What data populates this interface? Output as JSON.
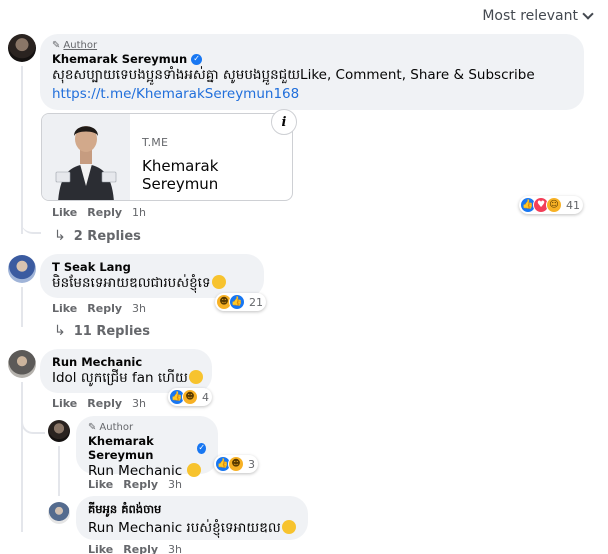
{
  "sort": {
    "label": "Most relevant"
  },
  "comments": [
    {
      "author_tag": "Author",
      "name": "Khemarak Sereymun",
      "text": "សុខសប្បាយទេបងប្អូនទាំងអស់គ្នា សូមបងប្អូនជួយLike, Comment, Share & Subscribe",
      "link": "https://t.me/KhemarakSereymun168",
      "card": {
        "domain": "T.ME",
        "title": "Khemarak Sereymun"
      },
      "like": "Like",
      "reply": "Reply",
      "time": "1h",
      "reaction_count": "41",
      "replies_label": "2 Replies"
    },
    {
      "name": "T Seak Lang",
      "text": "មិនមែនទេអាយឌលជារបស់ខ្ញុំទេ",
      "like": "Like",
      "reply": "Reply",
      "time": "3h",
      "reaction_count": "21",
      "replies_label": "11 Replies"
    },
    {
      "name": "Run Mechanic",
      "text": "Idol លូកជ្រើម fan ហើយ",
      "like": "Like",
      "reply": "Reply",
      "time": "3h",
      "reaction_count": "4",
      "replies": [
        {
          "author_tag": "Author",
          "name": "Khemarak Sereymun",
          "text": "Run Mechanic",
          "like": "Like",
          "reply": "Reply",
          "time": "3h",
          "reaction_count": "3"
        },
        {
          "name": "គីមអូន គំពង់ចាម",
          "mention": "Run Mechanic",
          "text": "របស់ខ្ញុំទេអាយឌល",
          "like": "Like",
          "reply": "Reply",
          "time": "3h"
        }
      ]
    }
  ],
  "icons": {
    "reaction_like": "like-icon",
    "reaction_love": "love-icon",
    "reaction_haha": "haha-icon",
    "reaction_care": "care-icon",
    "reply_arrow": "reply-arrow-icon",
    "info": "info-icon",
    "verified": "verified-badge-icon",
    "pencil": "pencil-icon"
  },
  "colors": {
    "link": "#216fdb",
    "like_blue": "#1877f2",
    "love_red": "#f33e58",
    "haha_yellow": "#f7b125",
    "bubble": "#f0f2f5",
    "secondary_text": "#65676b"
  }
}
